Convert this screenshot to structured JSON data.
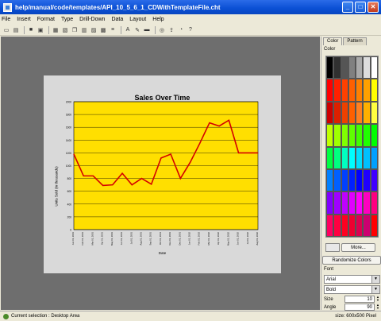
{
  "window": {
    "title": "help/manual/code/templates/API_10_5_6_1_CDWithTemplateFile.cht"
  },
  "menu": [
    "File",
    "Insert",
    "Format",
    "Type",
    "Drill-Down",
    "Data",
    "Layout",
    "Help"
  ],
  "toolbar": [
    "new-icon",
    "open-icon",
    "sep",
    "save-icon",
    "print-icon",
    "sep",
    "chart-icon",
    "image-icon",
    "copy-icon",
    "table-icon",
    "layout-icon",
    "grid-icon",
    "list-icon",
    "sep",
    "text-icon",
    "pen-icon",
    "picture-icon",
    "sep",
    "zoom-icon",
    "export-icon",
    "pie-icon",
    "help-icon"
  ],
  "right_panel": {
    "tabs": [
      "Color",
      "Pattern"
    ],
    "section_label": "Color",
    "more_label": "More...",
    "randomize_label": "Randomize Colors",
    "font_label": "Font",
    "font_name": "Arial",
    "font_style": "Bold",
    "size_label": "Size",
    "size_value": "10",
    "angle_label": "Angle",
    "angle_value": "90"
  },
  "palette": [
    "#000000",
    "#303030",
    "#555555",
    "#808080",
    "#aaaaaa",
    "#dddddd",
    "#ffffff",
    "#ff0000",
    "#ff2000",
    "#ff4000",
    "#ff6000",
    "#ff8000",
    "#ffa000",
    "#ffff00",
    "#cc0000",
    "#dd2000",
    "#ee4000",
    "#ff6000",
    "#ff8020",
    "#ffb000",
    "#ffff40",
    "#c0ff00",
    "#a0ff00",
    "#80ff00",
    "#60ff00",
    "#40ff00",
    "#20ff00",
    "#00ff00",
    "#00ff40",
    "#00ff80",
    "#00ffc0",
    "#00ffff",
    "#00e0ff",
    "#00c0ff",
    "#00a0ff",
    "#0080ff",
    "#0060ff",
    "#0040ff",
    "#0020ff",
    "#0000ff",
    "#2000ff",
    "#4000ff",
    "#8000ff",
    "#a000ff",
    "#c000ff",
    "#e000ff",
    "#ff00ff",
    "#ff00c0",
    "#ff0080",
    "#ff0060",
    "#ff0040",
    "#ff0020",
    "#ee0030",
    "#dd0050",
    "#cc0070",
    "#ff0000"
  ],
  "status": {
    "left": "Current selection : Desktop Area",
    "right": "size: 600x500 Pixel"
  },
  "chart_data": {
    "type": "line",
    "title": "Sales Over Time",
    "xlabel": "Date",
    "ylabel": "Units Sold (in thousands)",
    "ylim": [
      0,
      2000
    ],
    "yticks": [
      0,
      200,
      400,
      600,
      800,
      1000,
      1200,
      1400,
      1600,
      1800,
      2000
    ],
    "x": [
      "Jan 01, 2001",
      "Feb 01, 2001",
      "Mar 01, 2001",
      "Apr 01, 2001",
      "May 01, 2001",
      "Jun 01, 2001",
      "Jul 01, 2001",
      "Aug 01, 2001",
      "Sep 01, 2001",
      "Oct 01, 2001",
      "Nov 01, 2001",
      "Dec 01, 2001",
      "Jan 01, 2002",
      "Feb 01, 2002",
      "Mar 01, 2002",
      "Apr 01, 2002",
      "May 01, 2002",
      "Jun 01, 2002",
      "Jul 01, 2002",
      "Aug 01, 2002"
    ],
    "series": [
      {
        "values": [
          1180,
          840,
          840,
          690,
          700,
          880,
          700,
          800,
          710,
          1120,
          1180,
          800,
          1050,
          1350,
          1670,
          1620,
          1710,
          1200,
          1200,
          1200
        ]
      }
    ],
    "line_color": "#d40000",
    "plot_background": "#ffdf00",
    "grid": true
  }
}
